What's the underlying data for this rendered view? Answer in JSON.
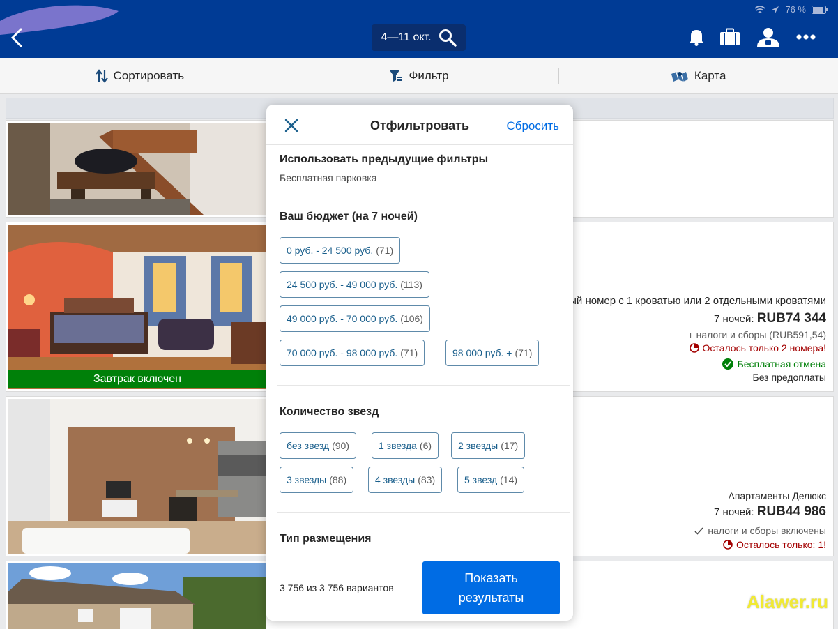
{
  "status": {
    "battery": "76 %"
  },
  "header": {
    "dates": "4—11 окт."
  },
  "tabs": [
    {
      "label": "Сортировать"
    },
    {
      "label": "Фильтр"
    },
    {
      "label": "Карта"
    }
  ],
  "cards": [
    {},
    {
      "ribbon": "Завтрак включен",
      "room": "ый номер с 1 кроватью или 2 отдельными кроватями",
      "nights": "7 ночей:",
      "price": "RUB74 344",
      "taxes": "+ налоги и сборы (RUB591,54)",
      "scarcity": "Осталось только 2 номера!",
      "free_cancel": "Бесплатная отмена",
      "no_prepay": "Без предоплаты"
    },
    {
      "room": "Апартаменты Делюкс",
      "nights": "7 ночей:",
      "price": "RUB44 986",
      "taxes": "налоги и сборы включены",
      "scarcity": "Осталось только: 1!"
    },
    {}
  ],
  "filter_modal": {
    "title": "Отфильтровать",
    "reset": "Сбросить",
    "previous": {
      "title": "Использовать предыдущие фильтры",
      "subtitle": "Бесплатная парковка"
    },
    "budget": {
      "title": "Ваш бюджет (на 7 ночей)",
      "chips": [
        {
          "label": "0 руб. - 24 500 руб.",
          "count": "(71)"
        },
        {
          "label": "24 500 руб. - 49 000 руб.",
          "count": "(113)"
        },
        {
          "label": "49 000 руб. - 70 000 руб.",
          "count": "(106)"
        },
        {
          "label": "70 000 руб. - 98 000 руб.",
          "count": "(71)"
        },
        {
          "label": "98 000 руб. +",
          "count": "(71)"
        }
      ]
    },
    "stars": {
      "title": "Количество звезд",
      "chips": [
        {
          "label": "без звезд",
          "count": "(90)"
        },
        {
          "label": "1 звезда",
          "count": "(6)"
        },
        {
          "label": "2 звезды",
          "count": "(17)"
        },
        {
          "label": "3 звезды",
          "count": "(88)"
        },
        {
          "label": "4 звезды",
          "count": "(83)"
        },
        {
          "label": "5 звезд",
          "count": "(14)"
        }
      ]
    },
    "accommodation": {
      "title": "Тип размещения"
    },
    "footer": {
      "count": "3 756 из 3 756 вариантов",
      "show_line1": "Показать",
      "show_line2": "результаты"
    }
  },
  "watermark": "Alawer.ru",
  "colors": {
    "brand": "#003b95",
    "accent": "#006ce4",
    "green": "#008009",
    "red": "#a30000"
  }
}
